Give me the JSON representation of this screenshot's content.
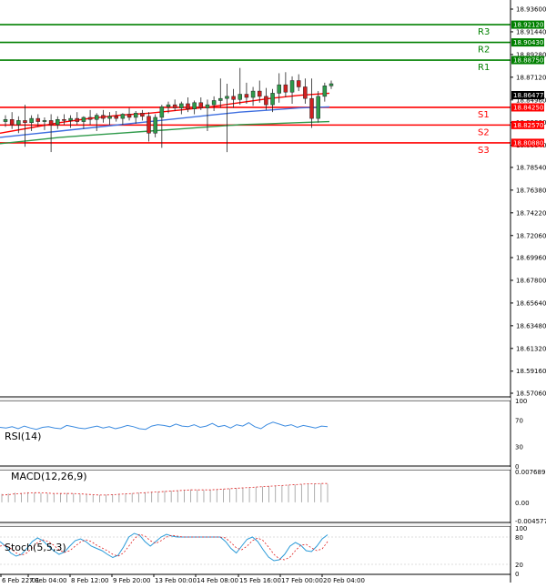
{
  "chart_data": {
    "type": "candlestick",
    "price_axis": {
      "ticks": [
        "18.93600",
        "18.91440",
        "18.89280",
        "18.87120",
        "18.84960",
        "18.82800",
        "18.80640",
        "18.78540",
        "18.76380",
        "18.74220",
        "18.72060",
        "18.69960",
        "18.67800",
        "18.65640",
        "18.63480",
        "18.61320",
        "18.59160",
        "18.57060"
      ],
      "ylim": [
        18.5706,
        18.936
      ]
    },
    "time_axis": {
      "ticks": [
        "6 Feb 22:01",
        "7 Feb 04:00",
        "8 Feb 12:00",
        "9 Feb 20:00",
        "13 Feb 00:00",
        "14 Feb 08:00",
        "15 Feb 16:00",
        "17 Feb 00:00",
        "20 Feb 04:00"
      ]
    },
    "current_price": {
      "label": "18.86477",
      "value": 18.86477
    },
    "levels": [
      {
        "name": "R3",
        "value": 18.9212,
        "label": "18.92120",
        "color": "#008000"
      },
      {
        "name": "R2",
        "value": 18.9043,
        "label": "18.90430",
        "color": "#008000"
      },
      {
        "name": "R1",
        "value": 18.8875,
        "label": "18.88750",
        "color": "#008000"
      },
      {
        "name": "S1",
        "value": 18.8425,
        "label": "18.84250",
        "color": "#ff0000"
      },
      {
        "name": "S2",
        "value": 18.8257,
        "label": "18.82570",
        "color": "#ff0000"
      },
      {
        "name": "S3",
        "value": 18.8088,
        "label": "18.80880",
        "color": "#ff0000"
      }
    ],
    "candles": [
      {
        "o": 18.829,
        "h": 18.835,
        "l": 18.824,
        "c": 18.831
      },
      {
        "o": 18.831,
        "h": 18.838,
        "l": 18.822,
        "c": 18.826
      },
      {
        "o": 18.826,
        "h": 18.834,
        "l": 18.818,
        "c": 18.83
      },
      {
        "o": 18.83,
        "h": 18.845,
        "l": 18.805,
        "c": 18.828
      },
      {
        "o": 18.828,
        "h": 18.835,
        "l": 18.82,
        "c": 18.832
      },
      {
        "o": 18.832,
        "h": 18.836,
        "l": 18.824,
        "c": 18.829
      },
      {
        "o": 18.829,
        "h": 18.833,
        "l": 18.821,
        "c": 18.83
      },
      {
        "o": 18.83,
        "h": 18.836,
        "l": 18.8,
        "c": 18.826
      },
      {
        "o": 18.826,
        "h": 18.834,
        "l": 18.822,
        "c": 18.831
      },
      {
        "o": 18.831,
        "h": 18.836,
        "l": 18.826,
        "c": 18.83
      },
      {
        "o": 18.83,
        "h": 18.835,
        "l": 18.823,
        "c": 18.832
      },
      {
        "o": 18.832,
        "h": 18.838,
        "l": 18.826,
        "c": 18.829
      },
      {
        "o": 18.829,
        "h": 18.834,
        "l": 18.822,
        "c": 18.833
      },
      {
        "o": 18.833,
        "h": 18.84,
        "l": 18.826,
        "c": 18.831
      },
      {
        "o": 18.831,
        "h": 18.837,
        "l": 18.82,
        "c": 18.835
      },
      {
        "o": 18.835,
        "h": 18.84,
        "l": 18.828,
        "c": 18.832
      },
      {
        "o": 18.832,
        "h": 18.838,
        "l": 18.826,
        "c": 18.834
      },
      {
        "o": 18.834,
        "h": 18.839,
        "l": 18.829,
        "c": 18.832
      },
      {
        "o": 18.832,
        "h": 18.837,
        "l": 18.826,
        "c": 18.836
      },
      {
        "o": 18.836,
        "h": 18.842,
        "l": 18.83,
        "c": 18.833
      },
      {
        "o": 18.833,
        "h": 18.839,
        "l": 18.827,
        "c": 18.837
      },
      {
        "o": 18.837,
        "h": 18.84,
        "l": 18.83,
        "c": 18.834
      },
      {
        "o": 18.834,
        "h": 18.838,
        "l": 18.81,
        "c": 18.818
      },
      {
        "o": 18.818,
        "h": 18.836,
        "l": 18.814,
        "c": 18.833
      },
      {
        "o": 18.833,
        "h": 18.845,
        "l": 18.804,
        "c": 18.843
      },
      {
        "o": 18.843,
        "h": 18.848,
        "l": 18.837,
        "c": 18.845
      },
      {
        "o": 18.845,
        "h": 18.85,
        "l": 18.839,
        "c": 18.842
      },
      {
        "o": 18.842,
        "h": 18.848,
        "l": 18.836,
        "c": 18.846
      },
      {
        "o": 18.846,
        "h": 18.852,
        "l": 18.838,
        "c": 18.841
      },
      {
        "o": 18.841,
        "h": 18.849,
        "l": 18.836,
        "c": 18.847
      },
      {
        "o": 18.847,
        "h": 18.852,
        "l": 18.84,
        "c": 18.842
      },
      {
        "o": 18.842,
        "h": 18.85,
        "l": 18.82,
        "c": 18.845
      },
      {
        "o": 18.845,
        "h": 18.853,
        "l": 18.839,
        "c": 18.849
      },
      {
        "o": 18.849,
        "h": 18.87,
        "l": 18.842,
        "c": 18.851
      },
      {
        "o": 18.851,
        "h": 18.865,
        "l": 18.8,
        "c": 18.853
      },
      {
        "o": 18.853,
        "h": 18.86,
        "l": 18.842,
        "c": 18.85
      },
      {
        "o": 18.85,
        "h": 18.88,
        "l": 18.845,
        "c": 18.855
      },
      {
        "o": 18.855,
        "h": 18.866,
        "l": 18.846,
        "c": 18.852
      },
      {
        "o": 18.852,
        "h": 18.862,
        "l": 18.844,
        "c": 18.858
      },
      {
        "o": 18.858,
        "h": 18.868,
        "l": 18.847,
        "c": 18.853
      },
      {
        "o": 18.853,
        "h": 18.861,
        "l": 18.84,
        "c": 18.845
      },
      {
        "o": 18.845,
        "h": 18.86,
        "l": 18.838,
        "c": 18.856
      },
      {
        "o": 18.856,
        "h": 18.875,
        "l": 18.847,
        "c": 18.864
      },
      {
        "o": 18.864,
        "h": 18.876,
        "l": 18.852,
        "c": 18.857
      },
      {
        "o": 18.857,
        "h": 18.872,
        "l": 18.846,
        "c": 18.868
      },
      {
        "o": 18.868,
        "h": 18.874,
        "l": 18.858,
        "c": 18.862
      },
      {
        "o": 18.862,
        "h": 18.87,
        "l": 18.846,
        "c": 18.851
      },
      {
        "o": 18.851,
        "h": 18.87,
        "l": 18.823,
        "c": 18.832
      },
      {
        "o": 18.832,
        "h": 18.858,
        "l": 18.828,
        "c": 18.853
      },
      {
        "o": 18.853,
        "h": 18.866,
        "l": 18.848,
        "c": 18.863
      },
      {
        "o": 18.863,
        "h": 18.868,
        "l": 18.86,
        "c": 18.865
      }
    ],
    "moving_averages": [
      {
        "color": "#ff0000",
        "values": [
          18.818,
          18.823,
          18.828,
          18.832,
          18.835,
          18.837,
          18.84,
          18.843,
          18.847,
          18.851,
          18.854,
          18.856
        ]
      },
      {
        "color": "#3f6fe0",
        "values": [
          18.814,
          18.817,
          18.82,
          18.823,
          18.826,
          18.829,
          18.832,
          18.835,
          18.838,
          18.84,
          18.842,
          18.843
        ]
      },
      {
        "color": "#2e9a4a",
        "values": [
          18.808,
          18.811,
          18.814,
          18.816,
          18.818,
          18.82,
          18.822,
          18.824,
          18.826,
          18.827,
          18.828,
          18.829
        ]
      }
    ],
    "rsi": {
      "label": "RSI(14)",
      "ticks": [
        "100",
        "70",
        "30",
        "0"
      ],
      "values": [
        59,
        58,
        60,
        57,
        61,
        58,
        56,
        59,
        60,
        58,
        57,
        62,
        60,
        58,
        57,
        59,
        61,
        58,
        60,
        57,
        59,
        62,
        60,
        57,
        56,
        61,
        63,
        62,
        60,
        64,
        61,
        60,
        63,
        59,
        61,
        65,
        60,
        62,
        58,
        63,
        61,
        66,
        60,
        57,
        63,
        67,
        64,
        61,
        63,
        59,
        62,
        60,
        58,
        61,
        60
      ]
    },
    "macd": {
      "label": "MACD(12,26,9)",
      "ticks": [
        "0.007689",
        "0.00",
        "-0.004577"
      ],
      "ylim": [
        -0.004577,
        0.007689
      ],
      "histogram": [
        0.0021,
        0.0022,
        0.0024,
        0.0023,
        0.0025,
        0.0024,
        0.0023,
        0.0022,
        0.0021,
        0.0022,
        0.0023,
        0.0022,
        0.0021,
        0.002,
        0.0019,
        0.0018,
        0.0019,
        0.002,
        0.0021,
        0.0022,
        0.0023,
        0.0024,
        0.0025,
        0.0026,
        0.0027,
        0.0028,
        0.0029,
        0.003,
        0.0031,
        0.0032,
        0.0031,
        0.003,
        0.0031,
        0.0032,
        0.0033,
        0.0034,
        0.0035,
        0.0036,
        0.0037,
        0.0038,
        0.0039,
        0.004,
        0.0041,
        0.0042,
        0.0043,
        0.0044,
        0.0045,
        0.0046,
        0.0047,
        0.0047,
        0.0046
      ],
      "signal": [
        0.0018,
        0.0019,
        0.0021,
        0.0022,
        0.0023,
        0.0024,
        0.0024,
        0.0023,
        0.0022,
        0.0022,
        0.0022,
        0.0022,
        0.0021,
        0.002,
        0.0019,
        0.0018,
        0.0018,
        0.0019,
        0.002,
        0.0021,
        0.0022,
        0.0023,
        0.0024,
        0.0025,
        0.0026,
        0.0027,
        0.0028,
        0.0029,
        0.003,
        0.0031,
        0.0031,
        0.0031,
        0.0031,
        0.0032,
        0.0033,
        0.0034,
        0.0035,
        0.0036,
        0.0037,
        0.0038,
        0.0039,
        0.004,
        0.0041,
        0.0042,
        0.0043,
        0.0044,
        0.0045,
        0.0046,
        0.0046,
        0.0047,
        0.0047
      ]
    },
    "stoch": {
      "label": "Stoch(5,5,3)",
      "ticks": [
        "100",
        "80",
        "20",
        "0"
      ],
      "main": [
        70,
        60,
        45,
        38,
        42,
        55,
        70,
        78,
        72,
        60,
        50,
        42,
        47,
        60,
        72,
        76,
        70,
        60,
        55,
        50,
        42,
        35,
        40,
        58,
        80,
        88,
        84,
        70,
        60,
        70,
        80,
        86,
        82,
        80,
        80,
        80,
        80,
        80,
        80,
        80,
        80,
        80,
        70,
        55,
        45,
        60,
        75,
        80,
        70,
        52,
        36,
        28,
        30,
        42,
        60,
        68,
        62,
        50,
        48,
        60,
        76,
        85
      ],
      "signal": [
        60,
        62,
        55,
        45,
        40,
        45,
        56,
        68,
        74,
        70,
        62,
        52,
        46,
        50,
        60,
        69,
        74,
        70,
        62,
        56,
        50,
        42,
        38,
        45,
        60,
        76,
        86,
        82,
        72,
        66,
        72,
        80,
        84,
        82,
        80,
        80,
        80,
        80,
        80,
        80,
        80,
        80,
        78,
        68,
        56,
        52,
        60,
        72,
        78,
        72,
        58,
        42,
        32,
        30,
        36,
        50,
        62,
        64,
        56,
        50,
        54,
        70
      ]
    }
  }
}
